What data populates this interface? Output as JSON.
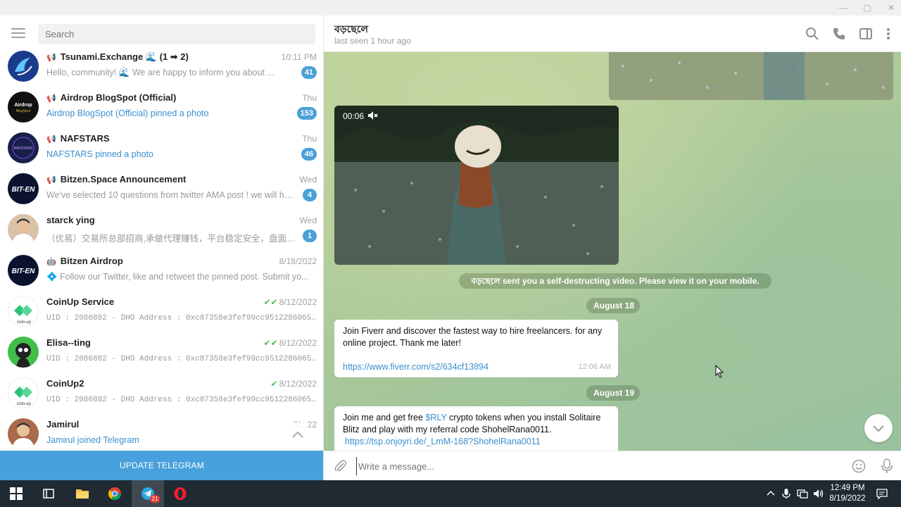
{
  "window": {
    "minimize": "—",
    "maximize": "▢",
    "close": "✕"
  },
  "search": {
    "placeholder": "Search"
  },
  "chats": [
    {
      "name": "Tsunami.Exchange 🌊 (1 ➡ 2)",
      "prefix": "📢",
      "time": "10:11 PM",
      "preview": "Hello, community! 🌊 We are happy to inform you about ...",
      "preview_style": "normal",
      "badge": "41",
      "avatar_color": "#1a3b8c",
      "avatar_icon": "wave-logo"
    },
    {
      "name": "Airdrop BlogSpot (Official)",
      "prefix": "📢",
      "time": "Thu",
      "preview": "Airdrop BlogSpot (Official) pinned a photo",
      "preview_style": "link",
      "badge": "153",
      "avatar_color": "#111111",
      "avatar_icon": "airdrop-logo"
    },
    {
      "name": "NAFSTARS",
      "prefix": "📢",
      "time": "Thu",
      "preview": "NAFSTARS pinned a photo",
      "preview_style": "link",
      "badge": "46",
      "avatar_color": "#1a1f4a",
      "avatar_icon": "nafstars-logo"
    },
    {
      "name": "Bitzen.Space Announcement",
      "prefix": "📢",
      "time": "Wed",
      "preview": "We've selected 10 questions from twitter AMA post ! we will hol...",
      "preview_style": "normal",
      "badge": "4",
      "avatar_color": "#0b1230",
      "avatar_icon": "bitzen-logo"
    },
    {
      "name": "starck ying",
      "prefix": "",
      "time": "Wed",
      "preview": "（优易）交易所总部招商,承做代理赚钱，平台稳定安全，盘面美...",
      "preview_style": "normal",
      "badge": "1",
      "avatar_color": "#d9c2a8",
      "avatar_icon": "person-photo"
    },
    {
      "name": "Bitzen Airdrop",
      "prefix": "🤖",
      "time": "8/18/2022",
      "preview": "💠 Follow our Twitter, like and retweet the pinned post. Submit yo...",
      "preview_style": "normal",
      "badge": "",
      "avatar_color": "#0b1230",
      "avatar_icon": "bitzen-logo"
    },
    {
      "name": "CoinUp Service",
      "prefix": "",
      "time": "8/12/2022",
      "check": "✔✔",
      "preview": "UID : 2086882 - DHO Address : 0xc87358e3fef99cc9512286065fb...",
      "preview_style": "mono",
      "badge": "",
      "avatar_color": "#ffffff",
      "avatar_icon": "coinup-logo"
    },
    {
      "name": "Elisa--ting",
      "prefix": "",
      "time": "8/12/2022",
      "check": "✔✔",
      "preview": "UID : 2086882 - DHO Address : 0xc87358e3fef99cc9512286065fb...",
      "preview_style": "mono",
      "badge": "",
      "avatar_color": "#3fbf4a",
      "avatar_icon": "cartoon-avatar"
    },
    {
      "name": "CoinUp2",
      "prefix": "",
      "time": "8/12/2022",
      "check": "✔",
      "preview": "UID : 2086882 - DHO Address : 0xc87358e3fef99cc9512286065fb...",
      "preview_style": "mono",
      "badge": "",
      "avatar_color": "#ffffff",
      "avatar_icon": "coinup-logo"
    },
    {
      "name": "Jamirul",
      "prefix": "",
      "time": "8/...22",
      "preview": "Jamirul joined Telegram",
      "preview_style": "link",
      "badge": "",
      "avatar_color": "#a86a4a",
      "avatar_icon": "person-photo"
    }
  ],
  "update_button": "UPDATE TELEGRAM",
  "conversation": {
    "peer_name": "বড়ছেলে",
    "peer_status": "last seen 1 hour ago",
    "video_time": "00:06",
    "self_destruct_notice": "বড়ছেলে sent you a self-destructing video. Please view it on your mobile.",
    "date1": "August 18",
    "msg1_text": "Join Fiverr and discover the fastest way to hire freelancers. for any online project. Thank me later!",
    "msg1_link": "https://www.fiverr.com/s2/634cf13894",
    "msg1_time": "12:06 AM",
    "date2": "August 19",
    "msg2_text_before": "Join me and get free ",
    "msg2_ticker": "$RLY",
    "msg2_text_after": " crypto tokens when you install Solitaire Blitz and play with my referral code ShohelRana0011.",
    "msg2_link": "https://tsp.onjoyri.de/_LmM-168?ShohelRana0011"
  },
  "composer": {
    "placeholder": "Write a message..."
  },
  "taskbar": {
    "time": "12:49 PM",
    "date": "8/19/2022",
    "telegram_badge": "21",
    "colors": {
      "bar": "#1f2a33",
      "accent": "#48a0dc"
    }
  }
}
